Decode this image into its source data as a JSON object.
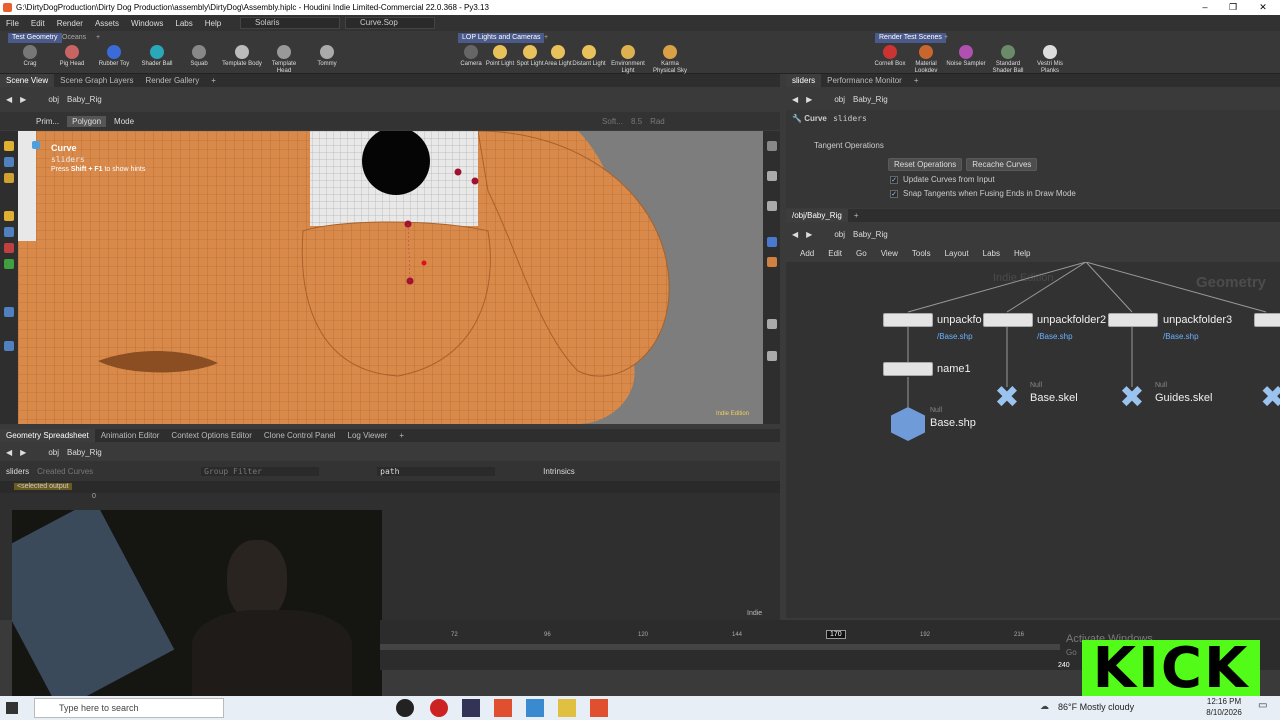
{
  "window": {
    "title": "G:\\DirtyDogProduction\\Dirty Dog Production\\assembly\\DirtyDog\\Assembly.hiplc - Houdini Indie Limited-Commercial 22.0.368 - Py3.13"
  },
  "menu": [
    "File",
    "Edit",
    "Render",
    "Assets",
    "Windows",
    "Labs",
    "Help"
  ],
  "desktop": {
    "solaris": "Solaris",
    "sop": "Curve.Sop"
  },
  "shelf_left": {
    "tabs": [
      "Test Geometry",
      "Oceans"
    ],
    "tools": [
      "Crag",
      "Pig Head",
      "Rubber Toy",
      "Shader Ball",
      "Squab",
      "Template Body",
      "Template Head",
      "Tommy"
    ]
  },
  "shelf_mid": {
    "tabs": [
      "LOP Lights and Cameras"
    ],
    "tools": [
      "Camera",
      "Point Light",
      "Spot Light",
      "Area Light",
      "Distant Light",
      "Environment Light",
      "Karma Physical Sky Light"
    ]
  },
  "shelf_right": {
    "tabs": [
      "Render Test Scenes"
    ],
    "tools": [
      "Cornell Box",
      "Material Lookdev",
      "Noise Sampler",
      "Standard Shader Ball",
      "Vestri Mis Planks"
    ]
  },
  "scene_tabs": [
    "Scene View",
    "Scene Graph Layers",
    "Render Gallery"
  ],
  "path": {
    "obj": "obj",
    "node": "Baby_Rig"
  },
  "viewport_toolbar": {
    "prim": "Prim...",
    "polygon": "Polygon",
    "mode": "Mode",
    "soft": "Soft...",
    "soft_val": "8.5",
    "rad": "Rad"
  },
  "hud": {
    "title": "Curve",
    "name": "sliders",
    "hint_pre": "Press ",
    "hint_key": "Shift + F1",
    "hint_post": " to show hints"
  },
  "viewport_watermark": "Indie Edition",
  "param_tabs": [
    "sliders",
    "Performance Monitor"
  ],
  "param": {
    "type": "Curve",
    "name": "sliders",
    "section": "Tangent Operations",
    "reset": "Reset Operations",
    "recache": "Recache Curves",
    "opt1": "Update Curves from Input",
    "opt2": "Snap Tangents when Fusing Ends in Draw Mode"
  },
  "net_tabs": [
    "/obj/Baby_Rig"
  ],
  "net_menu": [
    "Add",
    "Edit",
    "Go",
    "View",
    "Tools",
    "Layout",
    "Labs",
    "Help"
  ],
  "net_watermark": {
    "indie": "Indie Edition",
    "context": "Geometry"
  },
  "nodes": {
    "n1": "unpackfo",
    "n2": "unpackfolder2",
    "n3": "unpackfolder3",
    "n1s": "/Base.shp",
    "n2s": "/Base.shp",
    "n3s": "/Base.shp",
    "name1": "name1",
    "baseshp": "Base.shp",
    "baseskel": "Base.skel",
    "guides": "Guides.skel",
    "null": "Null"
  },
  "bottom_tabs": [
    "Geometry Spreadsheet",
    "Animation Editor",
    "Context Options Editor",
    "Clone Control Panel",
    "Log Viewer"
  ],
  "spreadsheet": {
    "node": "sliders",
    "created": "Created Curves",
    "group_filter": "Group Filter",
    "path": "path",
    "intrinsics": "Intrinsics",
    "selected": "<selected output",
    "zero": "0",
    "indie": "Indie"
  },
  "timeline": {
    "ticks": [
      "72",
      "96",
      "120",
      "144",
      "170",
      "192",
      "216"
    ],
    "current": "170",
    "end": "240"
  },
  "activate": "Activate Windows",
  "activate2": "Go",
  "kick": "KICK",
  "taskbar": {
    "search": "Type here to search",
    "weather": "86°F  Mostly cloudy",
    "time": "12:16 PM",
    "date": "8/10/2026"
  },
  "colors": {
    "accent": "#4a5a8a",
    "kick": "#53fc18",
    "skin": "#d98a4a"
  }
}
